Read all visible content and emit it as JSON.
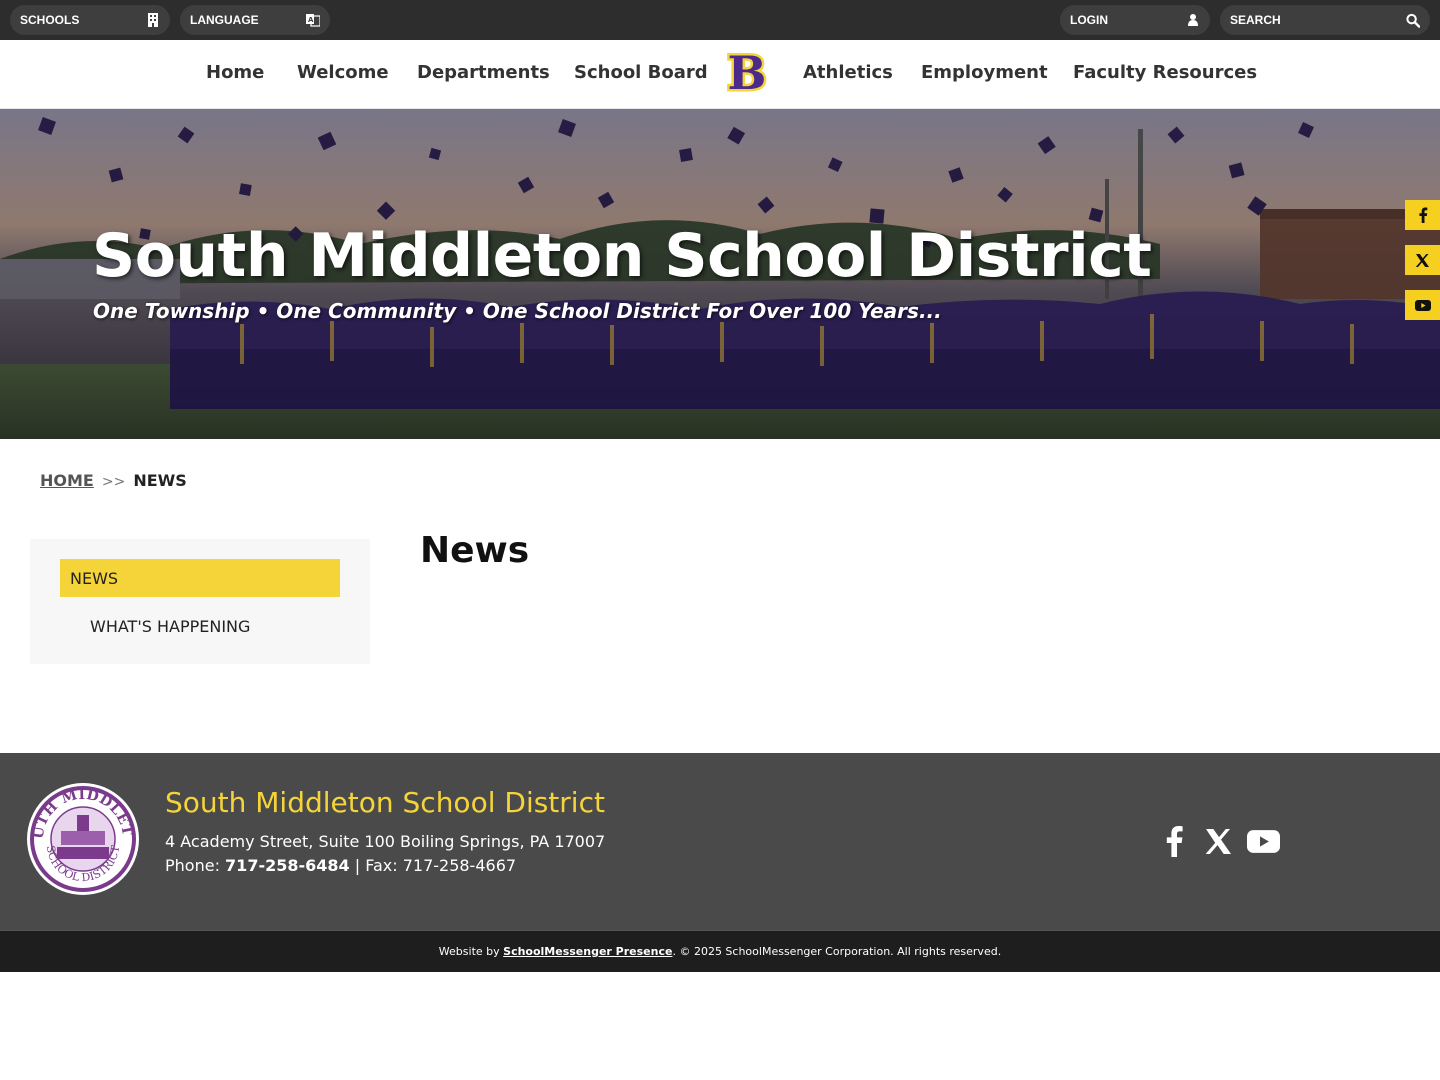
{
  "topbar": {
    "schools_label": "SCHOOLS",
    "language_label": "LANGUAGE",
    "login_label": "LOGIN",
    "search_placeholder": "SEARCH"
  },
  "nav": {
    "items": [
      "Home",
      "Welcome",
      "Departments",
      "School Board",
      "Athletics",
      "Employment",
      "Faculty Resources"
    ],
    "logo_letter": "B"
  },
  "hero": {
    "title": "South Middleton School District",
    "tagline": "One Township • One Community • One School District For Over 100 Years..."
  },
  "social_tabs": [
    "facebook-icon",
    "x-icon",
    "youtube-icon"
  ],
  "breadcrumb": {
    "home": "HOME",
    "separator": ">>",
    "current": "NEWS"
  },
  "sidebar": {
    "items": [
      "NEWS",
      "WHAT'S HAPPENING"
    ]
  },
  "main": {
    "heading": "News"
  },
  "footer": {
    "name": "South Middleton School District",
    "address": "4 Academy Street, Suite 100 Boiling Springs, PA 17007",
    "phone_label": "Phone: ",
    "phone": "717-258-6484",
    "fax": " | Fax: 717-258-4667",
    "seal_top_text": "SOUTH MIDDLETON",
    "seal_bottom_text": "SCHOOL DISTRICT",
    "credit_prefix": "Website by ",
    "credit_link": "SchoolMessenger Presence",
    "credit_suffix": ". © 2025 SchoolMessenger Corporation. All rights reserved."
  },
  "colors": {
    "accent_yellow": "#f5d43a",
    "brand_purple": "#4b2a8c",
    "topbar": "#2d2d2d",
    "footer": "#4a4a4a"
  }
}
